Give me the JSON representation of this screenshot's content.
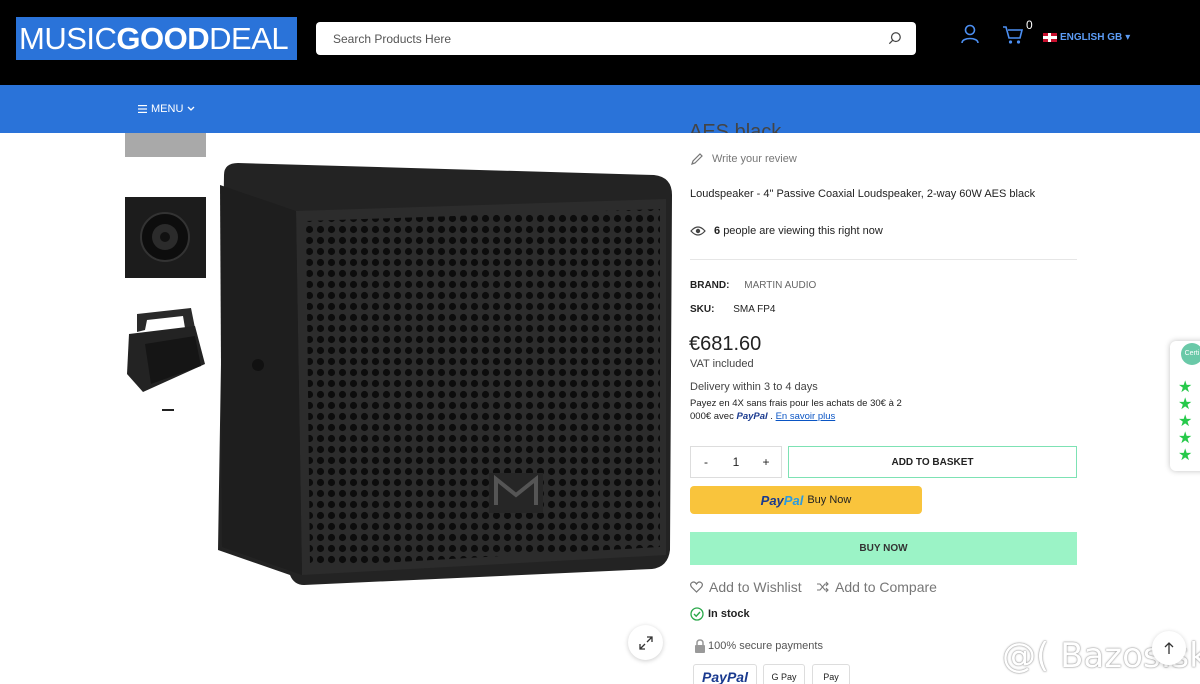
{
  "header": {
    "logo_light": "MUSIC",
    "logo_bold": "GOOD",
    "logo_end": "DEAL",
    "search_placeholder": "Search Products Here",
    "cart_count": "0",
    "language": "ENGLISH GB"
  },
  "nav": {
    "menu_label": "MENU"
  },
  "product": {
    "title_cut": "AES black",
    "review_link": "Write your review",
    "description": "Loudspeaker - 4\" Passive Coaxial Loudspeaker, 2-way 60W AES black",
    "viewing_count": "6",
    "viewing_text": "people are viewing this right now",
    "brand_label": "BRAND:",
    "brand_value": "MARTIN AUDIO",
    "sku_label": "SKU:",
    "sku_value": "SMA FP4",
    "price": "€681.60",
    "vat": "VAT included",
    "delivery": "Delivery within 3 to 4 days",
    "paylater_text": "Payez en 4X sans frais pour les achats de 30€ à 2 000€ avec",
    "paylater_brand": "PayPal",
    "paylater_link": "En savoir plus",
    "quantity": "1",
    "qty_minus": "-",
    "qty_plus": "+",
    "add_to_basket": "ADD TO BASKET",
    "paypal_brand_a": "Pay",
    "paypal_brand_b": "Pal",
    "paypal_buy": "Buy Now",
    "buy_now": "BUY NOW",
    "wishlist": "Add to Wishlist",
    "compare": "Add to Compare",
    "stock": "In stock",
    "secure": "100% secure payments",
    "badges": [
      "PayPal",
      "G Pay",
      "Pay"
    ]
  },
  "widget": {
    "cert_label": "Certi"
  },
  "watermark": "@( Bazos.sk",
  "colors": {
    "header_bg": "#000000",
    "menu_bg": "#2a73d9",
    "buy_now_bg": "#9bf3c6",
    "paypal_bg": "#f9c43c",
    "stars": "#26c94a"
  }
}
